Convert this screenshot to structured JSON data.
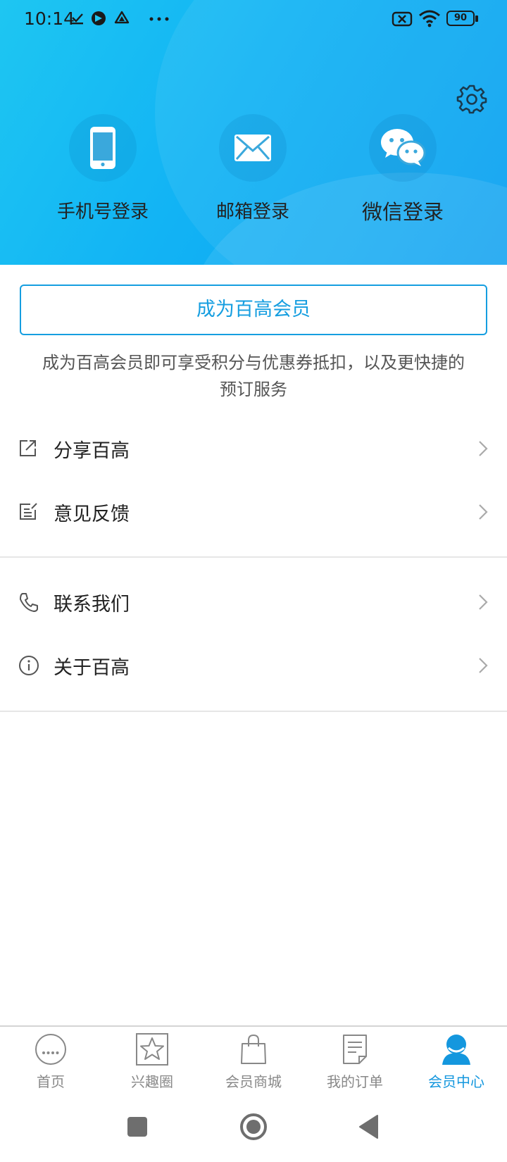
{
  "status_bar": {
    "time": "10:14",
    "battery": "90"
  },
  "login_options": [
    {
      "label": "手机号登录",
      "icon": "phone-icon"
    },
    {
      "label": "邮箱登录",
      "icon": "mail-icon"
    },
    {
      "label": "微信登录",
      "icon": "wechat-icon"
    }
  ],
  "member": {
    "button_label": "成为百高会员",
    "description_line1": "成为百高会员即可享受积分与优惠券抵扣，以及更快捷的",
    "description_line2": "预订服务"
  },
  "menu": [
    {
      "label": "分享百高",
      "icon": "share-icon"
    },
    {
      "label": "意见反馈",
      "icon": "feedback-icon"
    },
    {
      "label": "联系我们",
      "icon": "phone-call-icon"
    },
    {
      "label": "关于百高",
      "icon": "info-icon"
    }
  ],
  "tabs": [
    {
      "label": "首页",
      "icon": "home-dots-icon",
      "active": false
    },
    {
      "label": "兴趣圈",
      "icon": "star-icon",
      "active": false
    },
    {
      "label": "会员商城",
      "icon": "shopping-bag-icon",
      "active": false
    },
    {
      "label": "我的订单",
      "icon": "order-icon",
      "active": false
    },
    {
      "label": "会员中心",
      "icon": "user-icon",
      "active": true
    }
  ],
  "colors": {
    "accent": "#159ee0",
    "header_start": "#1ec6f2",
    "header_end": "#0aa0f0"
  }
}
